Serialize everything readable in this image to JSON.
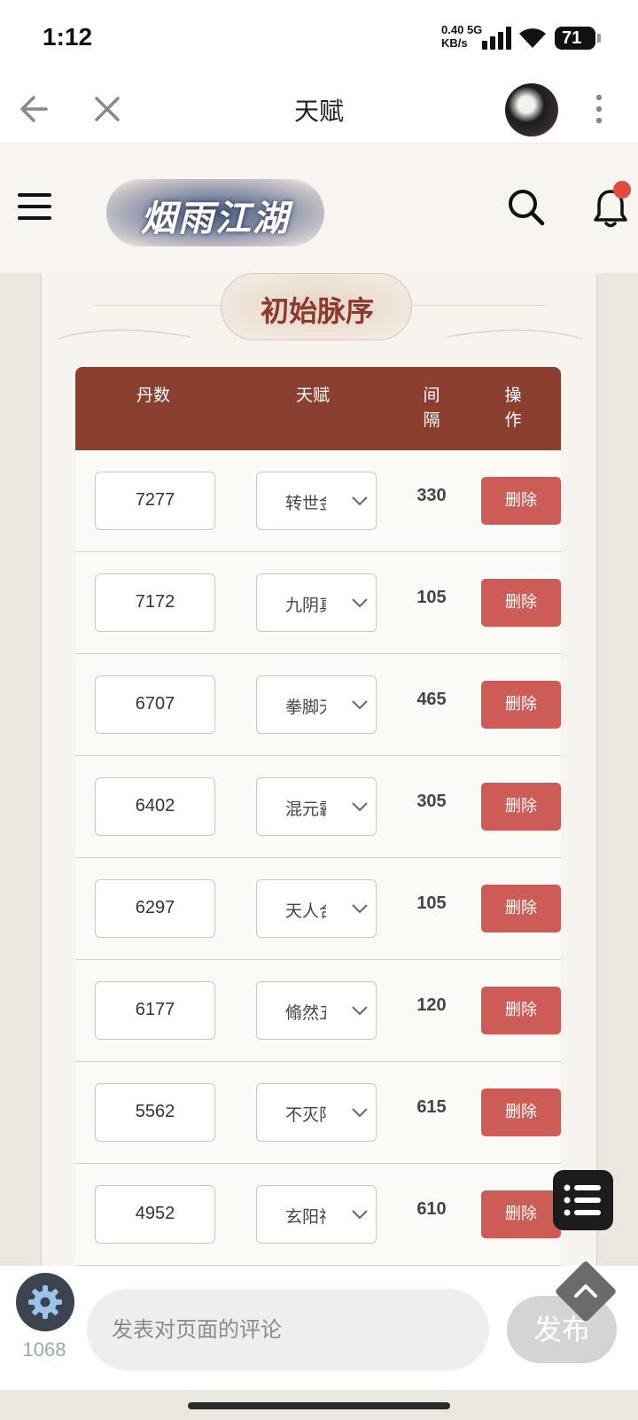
{
  "status_bar": {
    "time": "1:12",
    "net_speed": "0.40",
    "net_type": "5G",
    "net_unit": "KB/s",
    "battery": "71"
  },
  "nav": {
    "title": "天赋",
    "back_icon": "back-arrow-icon",
    "close_icon": "close-icon",
    "more_icon": "more-vertical-icon"
  },
  "site_header": {
    "logo_text": "烟雨江湖",
    "menu_icon": "menu-icon",
    "search_icon": "search-icon",
    "bell_icon": "bell-icon",
    "notification_dot_color": "#e34b3e"
  },
  "section": {
    "title": "初始脉序"
  },
  "table": {
    "headers": [
      "丹数",
      "天赋",
      "间\n隔",
      "操\n作"
    ],
    "header_bg": "#8a3f31",
    "delete_color": "#cd5c57",
    "rows": [
      {
        "dan": "7277",
        "talent": "转世金",
        "interval": "330",
        "action": "删除"
      },
      {
        "dan": "7172",
        "talent": "九阴真",
        "interval": "105",
        "action": "删除"
      },
      {
        "dan": "6707",
        "talent": "拳脚无",
        "interval": "465",
        "action": "删除"
      },
      {
        "dan": "6402",
        "talent": "混元霸",
        "interval": "305",
        "action": "删除"
      },
      {
        "dan": "6297",
        "talent": "天人合",
        "interval": "105",
        "action": "删除"
      },
      {
        "dan": "6177",
        "talent": "翛然五",
        "interval": "120",
        "action": "删除"
      },
      {
        "dan": "5562",
        "talent": "不灭阳",
        "interval": "615",
        "action": "删除"
      },
      {
        "dan": "4952",
        "talent": "玄阳神",
        "interval": "610",
        "action": "删除"
      }
    ]
  },
  "bottom": {
    "count": "1068",
    "comment_placeholder": "发表对页面的评论",
    "publish_label": "发布"
  }
}
